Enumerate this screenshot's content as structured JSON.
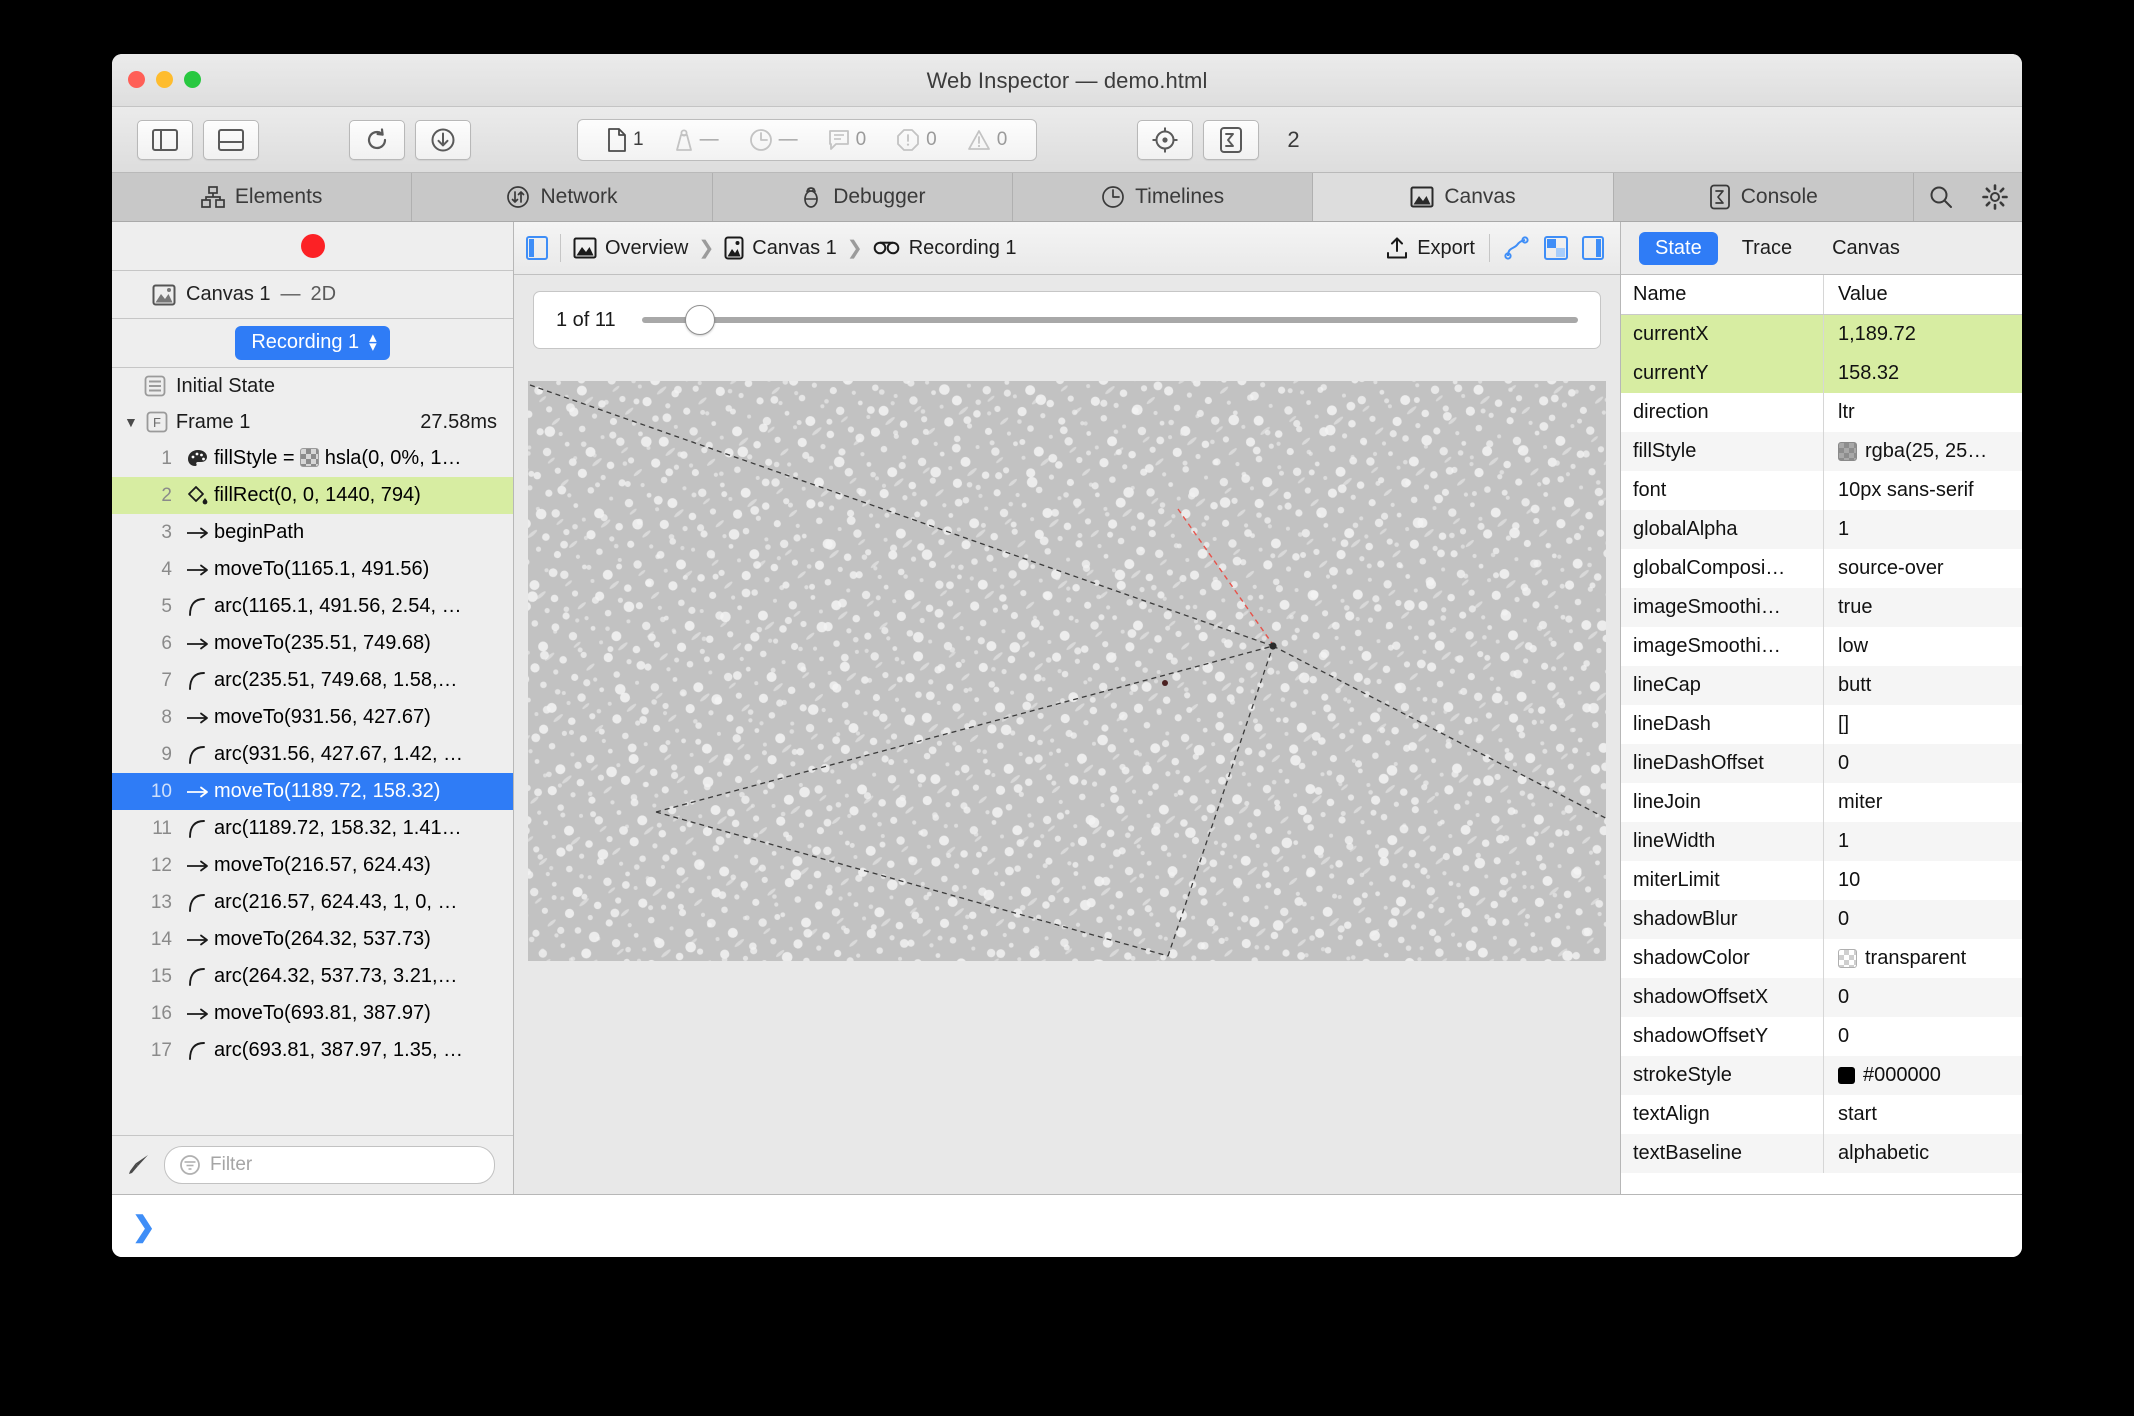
{
  "window": {
    "title": "Web Inspector — demo.html"
  },
  "toolbar": {
    "buttons": [
      {
        "name": "toggle-left-sidebar",
        "icon": "split-left-icon"
      },
      {
        "name": "toggle-bottom-drawer",
        "icon": "split-bottom-icon"
      },
      {
        "name": "reload-page",
        "icon": "reload-icon"
      },
      {
        "name": "download-page",
        "icon": "download-icon"
      }
    ],
    "stats": [
      {
        "name": "resource-count",
        "icon": "document-icon",
        "value": "1",
        "active": true
      },
      {
        "name": "resource-size",
        "icon": "weight-icon",
        "value": "—",
        "active": false
      },
      {
        "name": "load-time",
        "icon": "clock-icon",
        "value": "—",
        "active": false
      },
      {
        "name": "log-count",
        "icon": "message-icon",
        "value": "0",
        "active": false
      },
      {
        "name": "error-count",
        "icon": "error-icon",
        "value": "0",
        "active": false
      },
      {
        "name": "warning-count",
        "icon": "warning-icon",
        "value": "0",
        "active": false
      }
    ],
    "right_buttons": [
      {
        "name": "inspect-element",
        "icon": "crosshair-icon"
      },
      {
        "name": "console-toggle",
        "icon": "console-icon"
      }
    ],
    "tab_count": "2"
  },
  "tabs": [
    {
      "label": "Elements",
      "icon": "elements-icon",
      "selected": false
    },
    {
      "label": "Network",
      "icon": "network-icon",
      "selected": false
    },
    {
      "label": "Debugger",
      "icon": "debugger-icon",
      "selected": false
    },
    {
      "label": "Timelines",
      "icon": "timelines-icon",
      "selected": false
    },
    {
      "label": "Canvas",
      "icon": "canvas-icon",
      "selected": true
    },
    {
      "label": "Console",
      "icon": "console-icon",
      "selected": false
    }
  ],
  "tab_icons": [
    {
      "name": "search-icon"
    },
    {
      "name": "gear-icon"
    }
  ],
  "sidebar": {
    "canvas_item": {
      "label": "Canvas 1",
      "dash": "—",
      "type": "2D"
    },
    "recording_select": "Recording 1",
    "initial_state": "Initial State",
    "frame": {
      "label": "Frame 1",
      "duration": "27.58ms"
    },
    "commands": [
      {
        "index": "1",
        "icon": "palette-icon",
        "text": "fillStyle = ",
        "swatch": true,
        "text2": "hsla(0, 0%, 1…",
        "state": "none"
      },
      {
        "index": "2",
        "icon": "fill-icon",
        "text": "fillRect(0, 0, 1440, 794)",
        "state": "green"
      },
      {
        "index": "3",
        "icon": "arrow-icon",
        "text": "beginPath",
        "state": "none"
      },
      {
        "index": "4",
        "icon": "arrow-icon",
        "text": "moveTo(1165.1, 491.56)",
        "state": "none"
      },
      {
        "index": "5",
        "icon": "arc-icon",
        "text": "arc(1165.1, 491.56, 2.54, …",
        "state": "none"
      },
      {
        "index": "6",
        "icon": "arrow-icon",
        "text": "moveTo(235.51, 749.68)",
        "state": "none"
      },
      {
        "index": "7",
        "icon": "arc-icon",
        "text": "arc(235.51, 749.68, 1.58,…",
        "state": "none"
      },
      {
        "index": "8",
        "icon": "arrow-icon",
        "text": "moveTo(931.56, 427.67)",
        "state": "none"
      },
      {
        "index": "9",
        "icon": "arc-icon",
        "text": "arc(931.56, 427.67, 1.42, …",
        "state": "none"
      },
      {
        "index": "10",
        "icon": "arrow-icon",
        "text": "moveTo(1189.72, 158.32)",
        "state": "blue"
      },
      {
        "index": "11",
        "icon": "arc-icon",
        "text": "arc(1189.72, 158.32, 1.41…",
        "state": "none"
      },
      {
        "index": "12",
        "icon": "arrow-icon",
        "text": "moveTo(216.57, 624.43)",
        "state": "none"
      },
      {
        "index": "13",
        "icon": "arc-icon",
        "text": "arc(216.57, 624.43, 1, 0, …",
        "state": "none"
      },
      {
        "index": "14",
        "icon": "arrow-icon",
        "text": "moveTo(264.32, 537.73)",
        "state": "none"
      },
      {
        "index": "15",
        "icon": "arc-icon",
        "text": "arc(264.32, 537.73, 3.21,…",
        "state": "none"
      },
      {
        "index": "16",
        "icon": "arrow-icon",
        "text": "moveTo(693.81, 387.97)",
        "state": "none"
      },
      {
        "index": "17",
        "icon": "arc-icon",
        "text": "arc(693.81, 387.97, 1.35, …",
        "state": "none"
      }
    ],
    "filter_placeholder": "Filter"
  },
  "navbar": {
    "breadcrumbs": [
      {
        "label": "Overview",
        "icon": "overview-icon"
      },
      {
        "label": "Canvas 1",
        "icon": "canvas-thumb-icon"
      },
      {
        "label": "Recording 1",
        "icon": "recording-icon"
      }
    ],
    "separator": "❯",
    "export_label": "Export",
    "right_buttons": [
      {
        "name": "show-path-button",
        "icon": "path-icon"
      },
      {
        "name": "show-grid-button",
        "icon": "grid-icon"
      },
      {
        "name": "toggle-right-sidebar-button",
        "icon": "sidebar-right-icon"
      }
    ]
  },
  "player": {
    "position_label": "1 of 11",
    "current": 1,
    "total": 11,
    "knob_percent": 6.2
  },
  "right_panel": {
    "tabs": [
      {
        "label": "State",
        "active": true
      },
      {
        "label": "Trace",
        "active": false
      },
      {
        "label": "Canvas",
        "active": false
      }
    ],
    "columns": [
      "Name",
      "Value"
    ],
    "rows": [
      {
        "name": "currentX",
        "value": "1,189.72",
        "highlight": true,
        "swatch": "none"
      },
      {
        "name": "currentY",
        "value": "158.32",
        "highlight": true,
        "swatch": "none"
      },
      {
        "name": "direction",
        "value": "ltr",
        "swatch": "none"
      },
      {
        "name": "fillStyle",
        "value": "rgba(25, 25…",
        "swatch": "gray"
      },
      {
        "name": "font",
        "value": "10px sans-serif",
        "swatch": "none"
      },
      {
        "name": "globalAlpha",
        "value": "1",
        "swatch": "none"
      },
      {
        "name": "globalComposi…",
        "value": "source-over",
        "swatch": "none"
      },
      {
        "name": "imageSmoothi…",
        "value": "true",
        "swatch": "none"
      },
      {
        "name": "imageSmoothi…",
        "value": "low",
        "swatch": "none"
      },
      {
        "name": "lineCap",
        "value": "butt",
        "swatch": "none"
      },
      {
        "name": "lineDash",
        "value": "[]",
        "swatch": "none"
      },
      {
        "name": "lineDashOffset",
        "value": "0",
        "swatch": "none"
      },
      {
        "name": "lineJoin",
        "value": "miter",
        "swatch": "none"
      },
      {
        "name": "lineWidth",
        "value": "1",
        "swatch": "none"
      },
      {
        "name": "miterLimit",
        "value": "10",
        "swatch": "none"
      },
      {
        "name": "shadowBlur",
        "value": "0",
        "swatch": "none"
      },
      {
        "name": "shadowColor",
        "value": "transparent",
        "swatch": "transparent"
      },
      {
        "name": "shadowOffsetX",
        "value": "0",
        "swatch": "none"
      },
      {
        "name": "shadowOffsetY",
        "value": "0",
        "swatch": "none"
      },
      {
        "name": "strokeStyle",
        "value": "#000000",
        "swatch": "black"
      },
      {
        "name": "textAlign",
        "value": "start",
        "swatch": "none"
      },
      {
        "name": "textBaseline",
        "value": "alphabetic",
        "swatch": "none"
      }
    ]
  },
  "console": {
    "prompt": "❯"
  },
  "colors": {
    "accent_blue": "#2f7cf6",
    "highlight_green": "#d7eda2",
    "record_red": "#fc2125",
    "canvas_bg": "#c2c2c2",
    "path_stroke": "#3a3a3a",
    "active_path_stroke": "#e8524a"
  }
}
